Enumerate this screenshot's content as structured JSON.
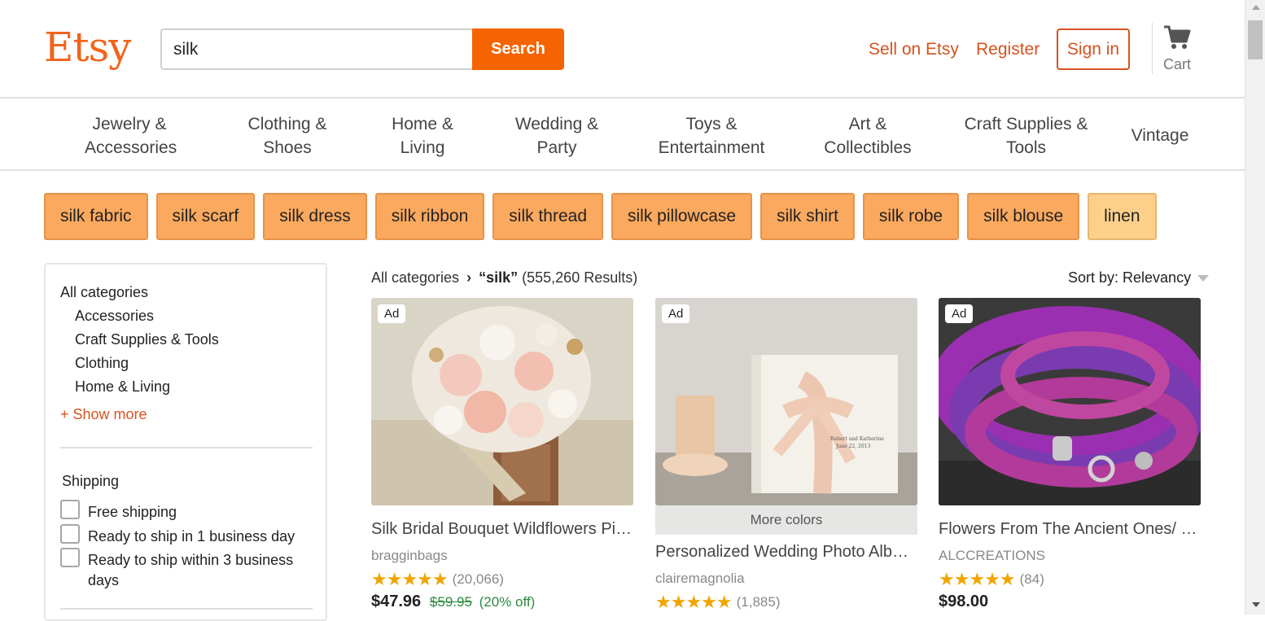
{
  "brand": {
    "logo_text": "Etsy",
    "accent_color": "#f1641e"
  },
  "search": {
    "value": "silk",
    "button_label": "Search"
  },
  "header_links": {
    "sell": "Sell on Etsy",
    "register": "Register",
    "sign_in": "Sign in",
    "cart": "Cart",
    "cart_icon": "cart-icon"
  },
  "categories": [
    {
      "line1": "Jewelry &",
      "line2": "Accessories"
    },
    {
      "line1": "Clothing &",
      "line2": "Shoes"
    },
    {
      "line1": "Home &",
      "line2": "Living"
    },
    {
      "line1": "Wedding &",
      "line2": "Party"
    },
    {
      "line1": "Toys &",
      "line2": "Entertainment"
    },
    {
      "line1": "Art &",
      "line2": "Collectibles"
    },
    {
      "line1": "Craft Supplies &",
      "line2": "Tools"
    },
    {
      "line1": "Vintage",
      "line2": ""
    }
  ],
  "chips": [
    "silk fabric",
    "silk scarf",
    "silk dress",
    "silk ribbon",
    "silk thread",
    "silk pillowcase",
    "silk shirt",
    "silk robe",
    "silk blouse",
    "linen"
  ],
  "sidebar": {
    "title": "All categories",
    "items": [
      "Accessories",
      "Craft Supplies & Tools",
      "Clothing",
      "Home & Living"
    ],
    "show_more": "+ Show more",
    "shipping_title": "Shipping",
    "shipping_options": [
      "Free shipping",
      "Ready to ship in 1 business day",
      "Ready to ship within 3 business days"
    ]
  },
  "results": {
    "crumb_root": "All categories",
    "query": "“silk”",
    "count": "(555,260 Results)",
    "sort_label": "Sort by: Relevancy"
  },
  "listings": [
    {
      "ad": "Ad",
      "title": "Silk Bridal Bouquet Wildflowers Pink Blush Ivory",
      "shop": "bragginbags",
      "stars": "★★★★★",
      "reviews": "(20,066)",
      "price": "$47.96",
      "original_price": "$59.95",
      "discount": "(20% off)",
      "more_colors": ""
    },
    {
      "ad": "Ad",
      "title": "Personalized Wedding Photo Album with Silk Ribbon",
      "shop": "clairemagnolia",
      "stars": "★★★★★",
      "reviews": "(1,885)",
      "price": "",
      "original_price": "",
      "discount": "",
      "more_colors": "More colors",
      "photo_caption": "Robert and Katherine",
      "photo_date": "June 22, 2013"
    },
    {
      "ad": "Ad",
      "title": "Flowers From The Ancient Ones/ knit silk bracelet",
      "shop": "ALCCREATIONS",
      "stars": "★★★★★",
      "reviews": "(84)",
      "price": "$98.00",
      "original_price": "",
      "discount": "",
      "more_colors": ""
    }
  ]
}
